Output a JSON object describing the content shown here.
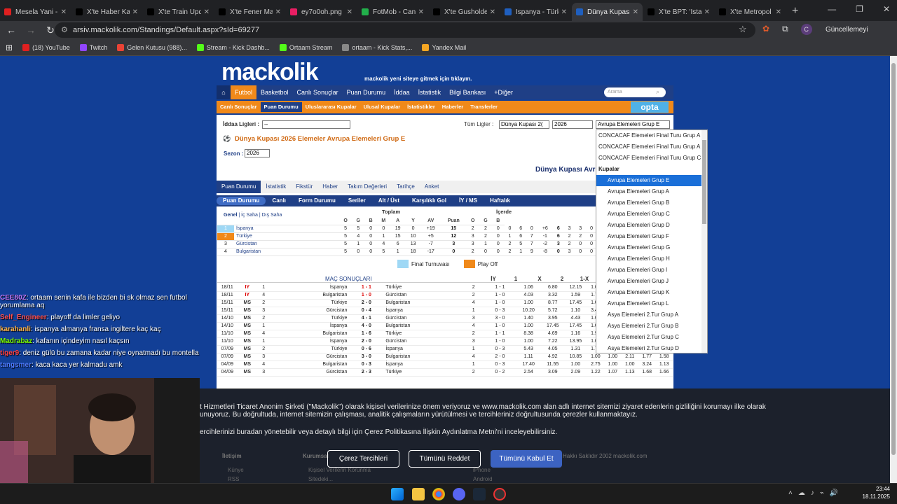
{
  "browser": {
    "tabs": [
      {
        "title": "Mesela Yani - ",
        "color": "#e02020"
      },
      {
        "title": "X'te Haber Kar",
        "color": "#000000"
      },
      {
        "title": "X'te Train Upd",
        "color": "#000000"
      },
      {
        "title": "X'te Fener Mar",
        "color": "#000000"
      },
      {
        "title": "ey7o0oh.png -",
        "color": "#e91e63"
      },
      {
        "title": "FotMob - Canlı",
        "color": "#22b04b"
      },
      {
        "title": "X'te Gusholder",
        "color": "#000000"
      },
      {
        "title": "İspanya - Türki",
        "color": "#1f5fbf"
      },
      {
        "title": "Dünya Kupası",
        "color": "#1f5fbf",
        "active": true
      },
      {
        "title": "X'te BPT: 'İstan",
        "color": "#000000"
      },
      {
        "title": "X'te Metropol",
        "color": "#000000"
      }
    ],
    "url": "arsiv.mackolik.com/Standings/Default.aspx?sId=69277",
    "update_label": "Güncellemeyi tamamla",
    "profile_initial": "C",
    "bookmarks": [
      {
        "label": "(18) YouTube",
        "color": "#e02020"
      },
      {
        "label": "Twitch",
        "color": "#9146ff"
      },
      {
        "label": "Gelen Kutusu (988)...",
        "color": "#ea4335"
      },
      {
        "label": "Stream - Kick Dashb...",
        "color": "#53fc18"
      },
      {
        "label": "Ortaam Stream",
        "color": "#53fc18"
      },
      {
        "label": "ortaam - Kick Stats,...",
        "color": "#888888"
      },
      {
        "label": "Yandex Mail",
        "color": "#f5a623"
      }
    ]
  },
  "site": {
    "logo": "mackolik",
    "logo_sub": "mackolik yeni siteye gitmek için tıklayın.",
    "main_nav": [
      "Futbol",
      "Basketbol",
      "Canlı Sonuçlar",
      "Puan Durumu",
      "İddaa",
      "İstatistik",
      "Bilgi Bankası",
      "+Diğer"
    ],
    "search_placeholder": "Arama",
    "sub_nav": [
      "Canlı Sonuçlar",
      "Puan Durumu",
      "Uluslararası Kupalar",
      "Ulusal Kupalar",
      "İstatistikler",
      "Haberler",
      "Transferler"
    ],
    "opta": "opta",
    "iddaa_label": "İddaa Ligleri :",
    "iddaa_value": "--",
    "tum_ligler_label": "Tüm Ligler :",
    "league_value": "Dünya Kupası 2(",
    "year_value": "2026",
    "group_value": "Avrupa Elemeleri Grup E",
    "page_title": "Dünya Kupası 2026 Elemeler Avrupa Elemeleri Grup E",
    "sezon_label": "Sezon :",
    "sezon_value": "2026",
    "big_title": "Dünya Kupası Avru",
    "tabs1": [
      "Puan Durumu",
      "İstatistik",
      "Fikstür",
      "Haber",
      "Takım Değerleri",
      "Tarihçe",
      "Anket"
    ],
    "tabs2": [
      "Puan Durumu",
      "Canlı",
      "Form Durumu",
      "Seriler",
      "Alt / Üst",
      "Karşılıklı Gol",
      "İY / MS",
      "Haftalık"
    ],
    "filter": [
      "Genel",
      "İç Saha",
      "Dış Saha"
    ],
    "toplam": "Toplam",
    "icerde": "İçerde",
    "cols": [
      "O",
      "G",
      "B",
      "M",
      "A",
      "Y",
      "AV",
      "Puan"
    ],
    "cols_short": [
      "O",
      "G",
      "B",
      "M",
      "A",
      "Y",
      "AV",
      "Puan",
      "O",
      "G",
      "B"
    ],
    "standings": [
      {
        "pos": "1",
        "team": "İspanya",
        "color": "#9fd8f5",
        "t": [
          "5",
          "5",
          "0",
          "0",
          "19",
          "0",
          "+19",
          "15"
        ],
        "h": [
          "2",
          "2",
          "0",
          "0",
          "6",
          "0",
          "+6",
          "6"
        ],
        "a": [
          "3",
          "3",
          "0"
        ]
      },
      {
        "pos": "2",
        "team": "Türkiye",
        "color": "#f0891a",
        "t": [
          "5",
          "4",
          "0",
          "1",
          "15",
          "10",
          "+5",
          "12"
        ],
        "h": [
          "3",
          "2",
          "0",
          "1",
          "6",
          "7",
          "-1",
          "6"
        ],
        "a": [
          "2",
          "2",
          "0"
        ]
      },
      {
        "pos": "3",
        "team": "Gürcistan",
        "color": "",
        "t": [
          "5",
          "1",
          "0",
          "4",
          "6",
          "13",
          "-7",
          "3"
        ],
        "h": [
          "3",
          "1",
          "0",
          "2",
          "5",
          "7",
          "-2",
          "3"
        ],
        "a": [
          "2",
          "0",
          "0"
        ]
      },
      {
        "pos": "4",
        "team": "Bulgaristan",
        "color": "",
        "t": [
          "5",
          "0",
          "0",
          "5",
          "1",
          "18",
          "-17",
          "0"
        ],
        "h": [
          "2",
          "0",
          "0",
          "2",
          "1",
          "9",
          "-8",
          "0"
        ],
        "a": [
          "3",
          "0",
          "0"
        ]
      }
    ],
    "legend": [
      {
        "label": "Final Turnuvası",
        "color": "#9fd8f5"
      },
      {
        "label": "Play Off",
        "color": "#f0891a"
      }
    ],
    "results_title": "MAÇ SONUÇLARI",
    "results_cols": [
      "İY",
      "1",
      "X",
      "2",
      "1-X"
    ],
    "results": [
      {
        "d": "18/11",
        "s": "IY",
        "w": "1",
        "h": "İspanya",
        "sc": "1 - 1",
        "a": "Türkiye",
        "n": "2",
        "iy": "1 - 1",
        "o1": "1.06",
        "ox": "6.80",
        "o2": "12.15",
        "e": [
          "1.00"
        ]
      },
      {
        "d": "18/11",
        "s": "IY",
        "w": "4",
        "h": "Bulgaristan",
        "sc": "1 - 0",
        "a": "Gürcistan",
        "n": "2",
        "iy": "1 - 0",
        "o1": "4.03",
        "ox": "3.32",
        "o2": "1.59",
        "e": [
          "1.79"
        ]
      },
      {
        "d": "15/11",
        "s": "MS",
        "w": "2",
        "h": "Türkiye",
        "sc": "2 - 0",
        "a": "Bulgaristan",
        "n": "4",
        "iy": "1 - 0",
        "o1": "1.00",
        "ox": "8.77",
        "o2": "17.45",
        "e": [
          "1.00"
        ]
      },
      {
        "d": "15/11",
        "s": "MS",
        "w": "3",
        "h": "Gürcistan",
        "sc": "0 - 4",
        "a": "İspanya",
        "n": "1",
        "iy": "0 - 3",
        "o1": "10.20",
        "ox": "5.72",
        "o2": "1.10",
        "e": [
          "3.42"
        ]
      },
      {
        "d": "14/10",
        "s": "MS",
        "w": "2",
        "h": "Türkiye",
        "sc": "4 - 1",
        "a": "Gürcistan",
        "n": "3",
        "iy": "3 - 0",
        "o1": "1.40",
        "ox": "3.95",
        "o2": "4.43",
        "e": [
          "1.00"
        ]
      },
      {
        "d": "14/10",
        "s": "MS",
        "w": "1",
        "h": "İspanya",
        "sc": "4 - 0",
        "a": "Bulgaristan",
        "n": "4",
        "iy": "1 - 0",
        "o1": "1.00",
        "ox": "17.45",
        "o2": "17.45",
        "e": [
          "1.00"
        ]
      },
      {
        "d": "11/10",
        "s": "MS",
        "w": "4",
        "h": "Bulgaristan",
        "sc": "1 - 6",
        "a": "Türkiye",
        "n": "2",
        "iy": "1 - 1",
        "o1": "8.38",
        "ox": "4.69",
        "o2": "1.16",
        "e": [
          "1.99"
        ]
      },
      {
        "d": "11/10",
        "s": "MS",
        "w": "1",
        "h": "İspanya",
        "sc": "2 - 0",
        "a": "Gürcistan",
        "n": "3",
        "iy": "1 - 0",
        "o1": "1.00",
        "ox": "7.22",
        "o2": "13.95",
        "e": [
          "1.00"
        ]
      },
      {
        "d": "07/09",
        "s": "MS",
        "w": "2",
        "h": "Türkiye",
        "sc": "0 - 6",
        "a": "İspanya",
        "n": "1",
        "iy": "0 - 3",
        "o1": "5.43",
        "ox": "4.05",
        "o2": "1.31",
        "e": [
          "1.71"
        ]
      },
      {
        "d": "07/09",
        "s": "MS",
        "w": "3",
        "h": "Gürcistan",
        "sc": "3 - 0",
        "a": "Bulgaristan",
        "n": "4",
        "iy": "2 - 0",
        "o1": "1.11",
        "ox": "4.92",
        "o2": "10.85",
        "e": [
          "1.00",
          "1.00",
          "2.11",
          "1.77",
          "1.58"
        ]
      },
      {
        "d": "04/09",
        "s": "MS",
        "w": "4",
        "h": "Bulgaristan",
        "sc": "0 - 3",
        "a": "İspanya",
        "n": "1",
        "iy": "0 - 3",
        "o1": "17.40",
        "ox": "11.55",
        "o2": "1.00",
        "e": [
          "2.75",
          "1.00",
          "1.00",
          "3.24",
          "1.13"
        ]
      },
      {
        "d": "04/09",
        "s": "MS",
        "w": "3",
        "h": "Gürcistan",
        "sc": "2 - 3",
        "a": "Türkiye",
        "n": "2",
        "iy": "0 - 2",
        "o1": "2.54",
        "ox": "3.09",
        "o2": "2.09",
        "e": [
          "1.22",
          "1.07",
          "1.13",
          "1.68",
          "1.66"
        ]
      }
    ],
    "dropdown": {
      "top": [
        "CONCACAF Elemeleri Final Turu Grup A",
        "CONCACAF Elemeleri Final Turu Grup A",
        "CONCACAF Elemeleri Final Turu Grup C"
      ],
      "group": "Kupalar",
      "items": [
        "Avrupa Elemeleri Grup E",
        "Avrupa Elemeleri Grup A",
        "Avrupa Elemeleri Grup B",
        "Avrupa Elemeleri Grup C",
        "Avrupa Elemeleri Grup D",
        "Avrupa Elemeleri Grup F",
        "Avrupa Elemeleri Grup G",
        "Avrupa Elemeleri Grup H",
        "Avrupa Elemeleri Grup I",
        "Avrupa Elemeleri Grup J",
        "Avrupa Elemeleri Grup K",
        "Avrupa Elemeleri Grup L",
        "Asya Elemeleri 2.Tur Grup A",
        "Asya Elemeleri 2.Tur Grup B",
        "Asya Elemeleri 2.Tur Grup C",
        "Asya Elemeleri 2.Tur Grup D"
      ],
      "selected": 0
    }
  },
  "chat": [
    {
      "user": "CEE80Z",
      "color": "#c07bff",
      "msg": ": ortaam senin kafa ile bizden bi sk olmaz sen futbol yorumlama aq"
    },
    {
      "user": "Self_Engineer",
      "color": "#ff5050",
      "msg": ": playoff da limler geliyo"
    },
    {
      "user": "karahanli",
      "color": "#ffb347",
      "msg": ": ispanya almanya fransa ingiltere kaç kaç"
    },
    {
      "user": "Madrabaz",
      "color": "#7cfc00",
      "msg": ": kafanın içindeyim nasıl kaçsın"
    },
    {
      "user": "tiger9",
      "color": "#ff4040",
      "msg": ": deniz gülü bu zamana kadar niye oynatmadı bu montella"
    },
    {
      "user": "tangsmer",
      "color": "#4f7cff",
      "msg": ": kaca kaca yer kalmadu amk"
    }
  ],
  "cookie": {
    "line1": "t Hizmetleri Ticaret Anonim Şirketi (\"Mackolik\") olarak kişisel verilerinize önem veriyoruz ve www.mackolik.com alan adlı internet sitemizi ziyaret edenlerin gizliliğini korumayı ilke olarak",
    "line2": "unuyoruz. Bu doğrultuda, internet sitemizin çalışması, analitik çalışmaların yürütülmesi ve tercihleriniz doğrultusunda çerezler kullanmaktayız.",
    "line3": "ercihlerinizi buradan yönetebilir veya detaylı bilgi için Çerez Politikasına İlişkin Aydınlatma Metni'ni inceleyebilirsiniz.",
    "btn_prefs": "Çerez Tercihleri",
    "btn_reject": "Tümünü Reddet",
    "btn_accept": "Tümünü Kabul Et",
    "footer_items": [
      "İletişim",
      "Kurumsal",
      "Hakkı Saklıdır 2002 mackolik.com",
      "Künye",
      "Kişisel Verilerin Korunma",
      "iPhone",
      "RSS",
      "Sitedeki...",
      "Android"
    ]
  },
  "taskbar": {
    "time": "23:44",
    "date": "18.11.2025"
  }
}
